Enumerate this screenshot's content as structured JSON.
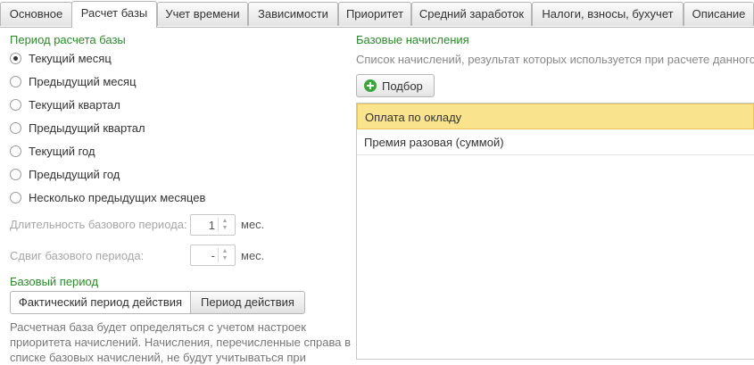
{
  "tabs": [
    {
      "label": "Основное",
      "active": false
    },
    {
      "label": "Расчет базы",
      "active": true
    },
    {
      "label": "Учет времени",
      "active": false
    },
    {
      "label": "Зависимости",
      "active": false
    },
    {
      "label": "Приоритет",
      "active": false
    },
    {
      "label": "Средний заработок",
      "active": false
    },
    {
      "label": "Налоги, взносы, бухучет",
      "active": false
    },
    {
      "label": "Описание",
      "active": false
    }
  ],
  "period": {
    "title": "Период расчета базы",
    "options": [
      {
        "label": "Текущий месяц",
        "checked": true
      },
      {
        "label": "Предыдущий месяц",
        "checked": false
      },
      {
        "label": "Текущий квартал",
        "checked": false
      },
      {
        "label": "Предыдущий квартал",
        "checked": false
      },
      {
        "label": "Текущий год",
        "checked": false
      },
      {
        "label": "Предыдущий год",
        "checked": false
      },
      {
        "label": "Несколько предыдущих месяцев",
        "checked": false
      }
    ],
    "duration_label": "Длительность базового периода:",
    "duration_value": "1",
    "shift_label": "Сдвиг базового периода:",
    "shift_value": "-",
    "unit": "мес."
  },
  "base_period": {
    "title": "Базовый период",
    "active_option": "Фактический период действия",
    "other_option": "Период действия",
    "description": "Расчетная база будет определяться с учетом настроек приоритета начислений. Начисления, перечисленные справа в списке базовых начислений, не будут учитываться при"
  },
  "accruals": {
    "title": "Базовые начисления",
    "hint": "Список начислений, результат которых используется при расчете данного",
    "pick_button": "Подбор",
    "items": [
      {
        "label": "Оплата по окладу",
        "selected": true
      },
      {
        "label": "Премия разовая (суммой)",
        "selected": false
      }
    ]
  },
  "colors": {
    "section_title": "#2a8a2a",
    "selected_row": "#f9e38c",
    "add_icon": "#3aa53a"
  }
}
